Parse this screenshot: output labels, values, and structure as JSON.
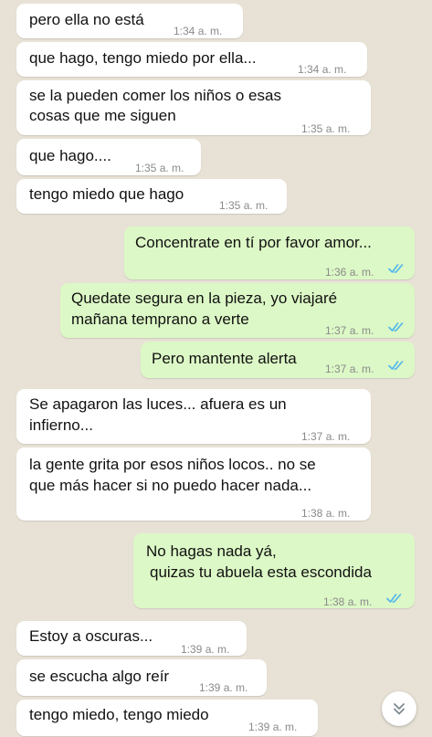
{
  "colors": {
    "wallpaper": "#e8e2d6",
    "incoming_bubble": "#ffffff",
    "outgoing_bubble": "#dcf8c6",
    "read_ticks": "#4fb6ec"
  },
  "icons": {
    "read_receipt": "double-check-icon",
    "scroll_down": "double-chevron-down-icon"
  },
  "messages": [
    {
      "direction": "in",
      "lines": [
        "pero ella no está"
      ],
      "time": "1:34 a. m."
    },
    {
      "direction": "in",
      "lines": [
        "que hago, tengo miedo por ella..."
      ],
      "time": "1:34 a. m."
    },
    {
      "direction": "in",
      "lines": [
        "se la pueden comer los niños o esas",
        "cosas que me siguen"
      ],
      "time": "1:35 a. m."
    },
    {
      "direction": "in",
      "lines": [
        "que hago...."
      ],
      "time": "1:35 a. m."
    },
    {
      "direction": "in",
      "lines": [
        "tengo miedo que hago"
      ],
      "time": "1:35 a. m."
    },
    {
      "direction": "out",
      "lines": [
        "Concentrate en tí por favor amor..."
      ],
      "time": "1:36 a. m.",
      "read": true
    },
    {
      "direction": "out",
      "lines": [
        "Quedate segura en la pieza, yo viajaré",
        "mañana temprano a verte"
      ],
      "time": "1:37 a. m.",
      "read": true
    },
    {
      "direction": "out",
      "lines": [
        "Pero mantente alerta"
      ],
      "time": "1:37 a. m.",
      "read": true
    },
    {
      "direction": "in",
      "lines": [
        "Se apagaron las luces... afuera es un",
        "infierno..."
      ],
      "time": "1:37 a. m."
    },
    {
      "direction": "in",
      "lines": [
        "la gente grita por esos niños locos.. no se",
        "que más hacer si no puedo hacer nada..."
      ],
      "time": "1:38 a. m."
    },
    {
      "direction": "out",
      "lines": [
        "No hagas nada yá,",
        "quizas tu abuela esta escondida"
      ],
      "time": "1:38 a. m.",
      "read": true
    },
    {
      "direction": "in",
      "lines": [
        "Estoy a oscuras..."
      ],
      "time": "1:39 a. m."
    },
    {
      "direction": "in",
      "lines": [
        "se escucha algo reír"
      ],
      "time": "1:39 a. m."
    },
    {
      "direction": "in",
      "lines": [
        "tengo miedo, tengo miedo"
      ],
      "time": "1:39 a. m."
    }
  ]
}
